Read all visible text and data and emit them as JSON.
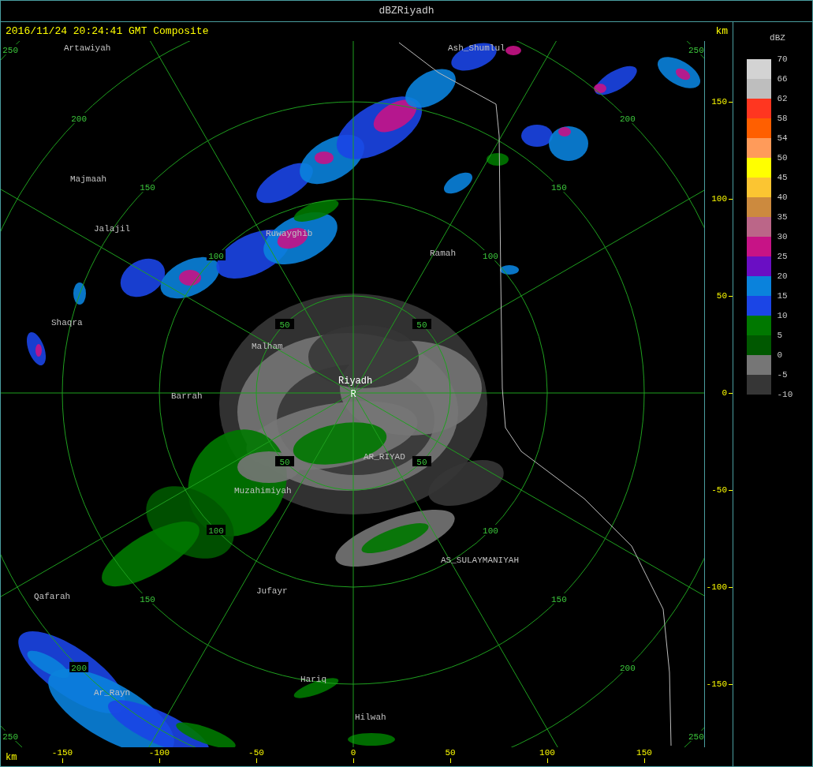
{
  "window": {
    "title": "dBZRiyadh"
  },
  "header": {
    "text": "2016/11/24 20:24:41 GMT Composite",
    "unit": "km"
  },
  "map": {
    "ring_labels": [
      [
        "50",
        "50",
        "50",
        "50"
      ],
      [
        "100",
        "100",
        "100",
        "100"
      ],
      [
        "150",
        "150",
        "150",
        "150"
      ],
      [
        "200",
        "200",
        "200",
        "200"
      ],
      [
        "250",
        "250",
        "250",
        "250"
      ]
    ],
    "radar_marker": "R",
    "places": [
      {
        "name": "Artawiyah",
        "kind": "town"
      },
      {
        "name": "Ash_Shumlul",
        "kind": "town"
      },
      {
        "name": "Majmaah",
        "kind": "town"
      },
      {
        "name": "Jalajil",
        "kind": "town"
      },
      {
        "name": "Ruwayghib",
        "kind": "town"
      },
      {
        "name": "Ramah",
        "kind": "town"
      },
      {
        "name": "Shaqra",
        "kind": "town"
      },
      {
        "name": "Malham",
        "kind": "town"
      },
      {
        "name": "Riyadh",
        "kind": "radar"
      },
      {
        "name": "Barrah",
        "kind": "town"
      },
      {
        "name": "AR_RIYAD",
        "kind": "town"
      },
      {
        "name": "Muzahimiyah",
        "kind": "town"
      },
      {
        "name": "AS_SULAYMANIYAH",
        "kind": "town"
      },
      {
        "name": "Qafarah",
        "kind": "town"
      },
      {
        "name": "Jufayr",
        "kind": "town"
      },
      {
        "name": "Hariq",
        "kind": "town"
      },
      {
        "name": "Ar_Rayn",
        "kind": "town"
      },
      {
        "name": "Hilwah",
        "kind": "town"
      }
    ]
  },
  "x_axis": {
    "unit": "km",
    "ticks": [
      "-150",
      "-100",
      "-50",
      "0",
      "50",
      "100",
      "150"
    ]
  },
  "y_axis": {
    "ticks": [
      "150",
      "100",
      "50",
      "0",
      "-50",
      "-100",
      "-150"
    ]
  },
  "legend": {
    "title": "dBZ",
    "bands": [
      {
        "color": "#d3d3d3"
      },
      {
        "color": "#bebebe"
      },
      {
        "color": "#ff3620"
      },
      {
        "color": "#ff5f00"
      },
      {
        "color": "#ff9b5a"
      },
      {
        "color": "#ffff00"
      },
      {
        "color": "#fbc532"
      },
      {
        "color": "#cc8a3e"
      },
      {
        "color": "#bb6688"
      },
      {
        "color": "#c71386"
      },
      {
        "color": "#6a0ec4"
      },
      {
        "color": "#0a82dc"
      },
      {
        "color": "#1b45e6"
      },
      {
        "color": "#007800"
      },
      {
        "color": "#005800"
      },
      {
        "color": "#767676"
      },
      {
        "color": "#363636"
      }
    ],
    "labels": [
      "70",
      "66",
      "62",
      "58",
      "54",
      "50",
      "45",
      "40",
      "35",
      "30",
      "25",
      "20",
      "15",
      "10",
      "5",
      "0",
      "-5",
      "-10"
    ]
  }
}
